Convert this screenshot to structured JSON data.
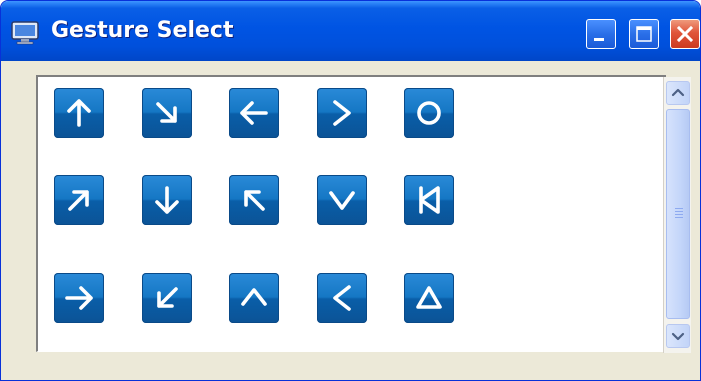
{
  "window": {
    "title": "Gesture Select",
    "icon": "monitor-icon",
    "controls": [
      "minimize-icon",
      "maximize-icon",
      "close-icon"
    ]
  },
  "colors": {
    "titlebar": "#0054e3",
    "window_body": "#ece9d8",
    "gesture_button": "#1577c4",
    "close_button": "#e0553a"
  },
  "gestures": [
    {
      "name": "up-arrow",
      "glyph": "↑"
    },
    {
      "name": "down-right-arrow",
      "glyph": "↘"
    },
    {
      "name": "left-arrow",
      "glyph": "←"
    },
    {
      "name": "greater-than",
      "glyph": ">"
    },
    {
      "name": "circle",
      "glyph": "○"
    },
    {
      "name": "up-right-arrow",
      "glyph": "↗"
    },
    {
      "name": "down-arrow",
      "glyph": "↓"
    },
    {
      "name": "up-left-arrow",
      "glyph": "↖"
    },
    {
      "name": "v-shape",
      "glyph": "∨"
    },
    {
      "name": "bowtie",
      "glyph": "⋈"
    },
    {
      "name": "right-arrow",
      "glyph": "→"
    },
    {
      "name": "down-left-arrow",
      "glyph": "↙"
    },
    {
      "name": "caret-up",
      "glyph": "∧"
    },
    {
      "name": "less-than",
      "glyph": "<"
    },
    {
      "name": "triangle",
      "glyph": "△"
    }
  ],
  "scrollbar": {
    "up_icon": "scroll-up-icon",
    "down_icon": "scroll-down-icon"
  }
}
